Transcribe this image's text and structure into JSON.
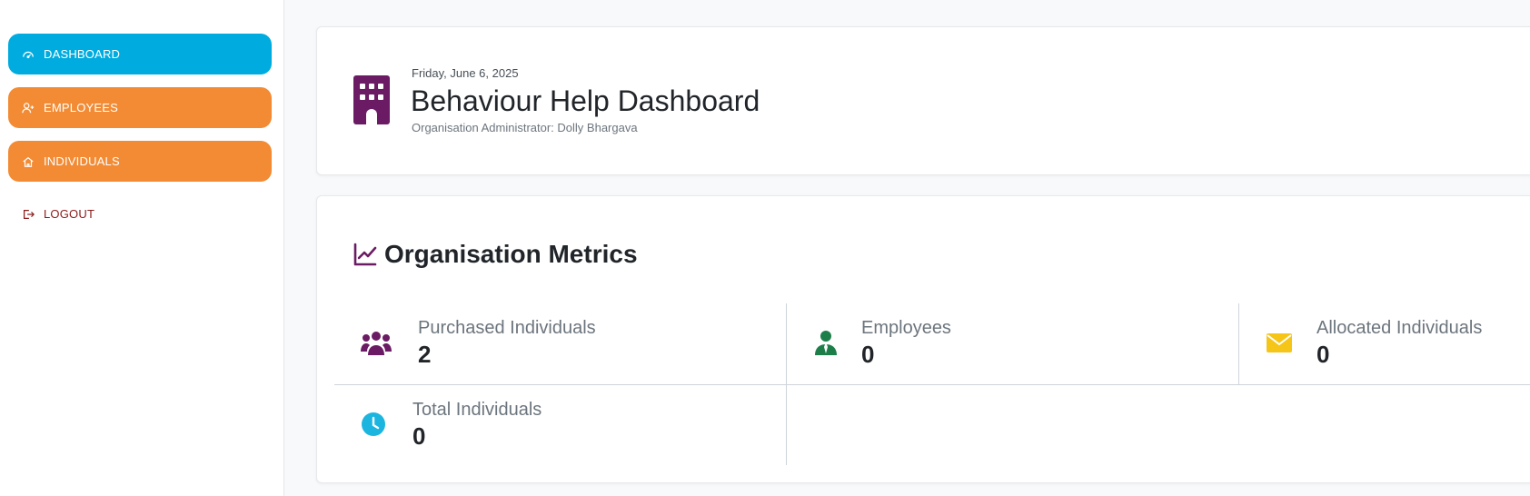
{
  "sidebar": {
    "items": [
      {
        "label": "DASHBOARD",
        "icon": "gauge-icon"
      },
      {
        "label": "EMPLOYEES",
        "icon": "user-plus-icon"
      },
      {
        "label": "INDIVIDUALS",
        "icon": "home-icon"
      },
      {
        "label": "LOGOUT",
        "icon": "logout-icon"
      }
    ]
  },
  "header": {
    "date": "Friday, June 6, 2025",
    "title": "Behaviour Help Dashboard",
    "subtitle": "Organisation Administrator: Dolly Bhargava",
    "icon": "building-icon"
  },
  "metrics": {
    "title": "Organisation Metrics",
    "items": [
      {
        "label": "Purchased Individuals",
        "value": "2",
        "icon": "users-icon",
        "color": "#6a1b63"
      },
      {
        "label": "Employees",
        "value": "0",
        "icon": "user-tie-icon",
        "color": "#1e7e4a"
      },
      {
        "label": "Allocated Individuals",
        "value": "0",
        "icon": "envelope-icon",
        "color": "#f5c518"
      },
      {
        "label": "Total Individuals",
        "value": "0",
        "icon": "clock-icon",
        "color": "#1cb5e0"
      }
    ]
  },
  "colors": {
    "accent_blue": "#00acdf",
    "accent_orange": "#f28b34",
    "brand_purple": "#6a1b63",
    "logout_red": "#8b1b1b"
  }
}
